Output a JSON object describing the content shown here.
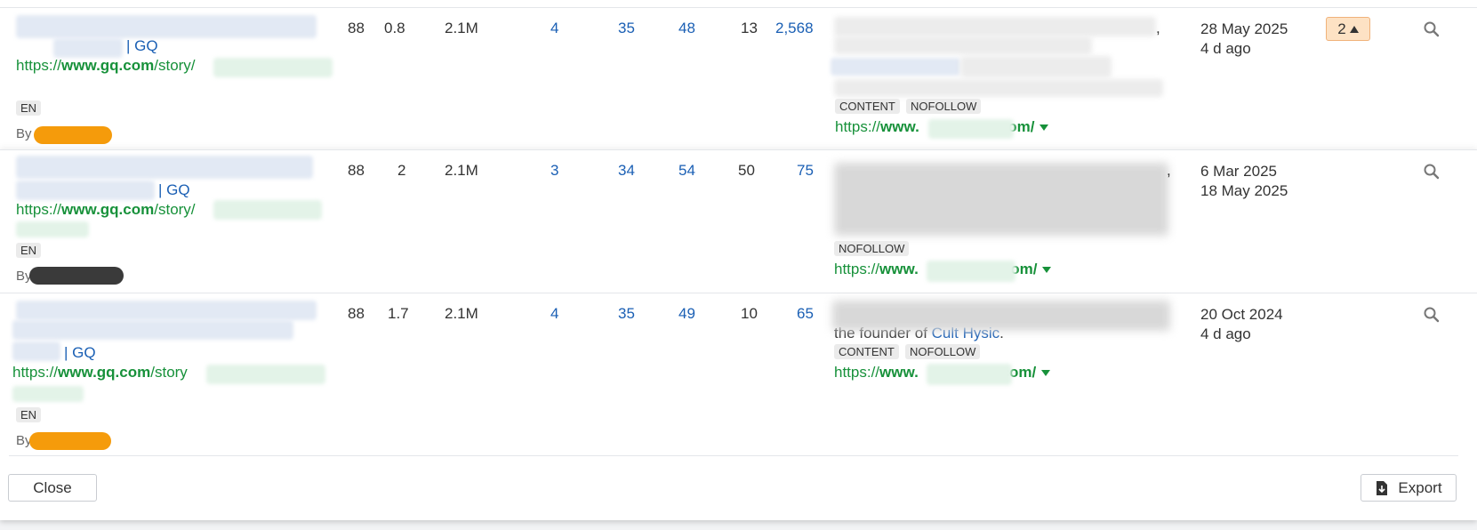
{
  "rows": [
    {
      "title_tail": "| GQ",
      "url_scheme": "https://",
      "url_domain": "www.gq.com",
      "url_path": "/story/",
      "lang": "EN",
      "by_label": "By",
      "col1": "88",
      "col2": "0.8",
      "col3": "2.1M",
      "col4": "4",
      "col5": "35",
      "col6": "48",
      "col7": "13",
      "col8": "2,568",
      "tags": [
        "CONTENT",
        "NOFOLLOW"
      ],
      "anchor_fragment": ",",
      "target_prefix": "https://",
      "target_domain_start": "www.",
      "target_domain_end": "com/",
      "date1": "28 May 2025",
      "date2": "4 d ago",
      "badge": "2",
      "scribble_color": "#f59b0b"
    },
    {
      "title_tail": "| GQ",
      "url_scheme": "https://",
      "url_domain": "www.gq.com",
      "url_path": "/story/",
      "lang": "EN",
      "by_label": "By",
      "col1": "88",
      "col2": "2",
      "col3": "2.1M",
      "col4": "3",
      "col5": "34",
      "col6": "54",
      "col7": "50",
      "col8": "75",
      "tags": [
        "NOFOLLOW"
      ],
      "anchor_fragment": ",",
      "target_prefix": "https://",
      "target_domain_start": "www.",
      "target_domain_end": "com/",
      "date1": "6 Mar 2025",
      "date2": "18 May 2025",
      "badge": "",
      "scribble_color": "#3a3a3a"
    },
    {
      "title_tail": "| GQ",
      "url_scheme": "https://",
      "url_domain": "www.gq.com",
      "url_path": "/story",
      "lang": "EN",
      "by_label": "By",
      "col1": "88",
      "col2": "1.7",
      "col3": "2.1M",
      "col4": "4",
      "col5": "35",
      "col6": "49",
      "col7": "10",
      "col8": "65",
      "tags": [
        "CONTENT",
        "NOFOLLOW"
      ],
      "anchor_text_visible": "the founder of",
      "anchor_link_visible": "Cult Hysic",
      "anchor_fragment": ".",
      "target_prefix": "https://",
      "target_domain_start": "www.",
      "target_domain_end": ".com/",
      "date1": "20 Oct 2024",
      "date2": "4 d ago",
      "badge": "",
      "scribble_color": "#f59b0b"
    }
  ],
  "footer": {
    "close_label": "Close",
    "export_label": "Export"
  },
  "icons": {
    "search": "search-icon",
    "caret": "chevron-down-icon",
    "export": "download-icon",
    "badge_arrow": "triangle-up-icon"
  }
}
